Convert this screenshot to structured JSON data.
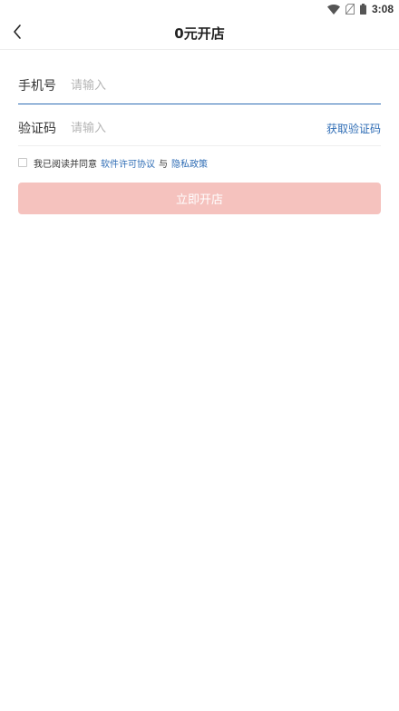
{
  "status_bar": {
    "time": "3:08",
    "icons": [
      "wifi-icon",
      "no-sim-icon",
      "battery-icon"
    ]
  },
  "header": {
    "title": "0元开店",
    "back_icon": "chevron-left-icon"
  },
  "form": {
    "phone": {
      "label": "手机号",
      "placeholder": "请输入",
      "value": ""
    },
    "code": {
      "label": "验证码",
      "placeholder": "请输入",
      "value": "",
      "get_code_label": "获取验证码"
    }
  },
  "agreement": {
    "checked": false,
    "prefix": "我已阅读并同意",
    "software_link": "软件许可协议",
    "connector": "与",
    "privacy_link": "隐私政策"
  },
  "submit": {
    "label": "立即开店"
  },
  "colors": {
    "accent": "#2f6db5",
    "submit_disabled": "#f5c2be"
  }
}
